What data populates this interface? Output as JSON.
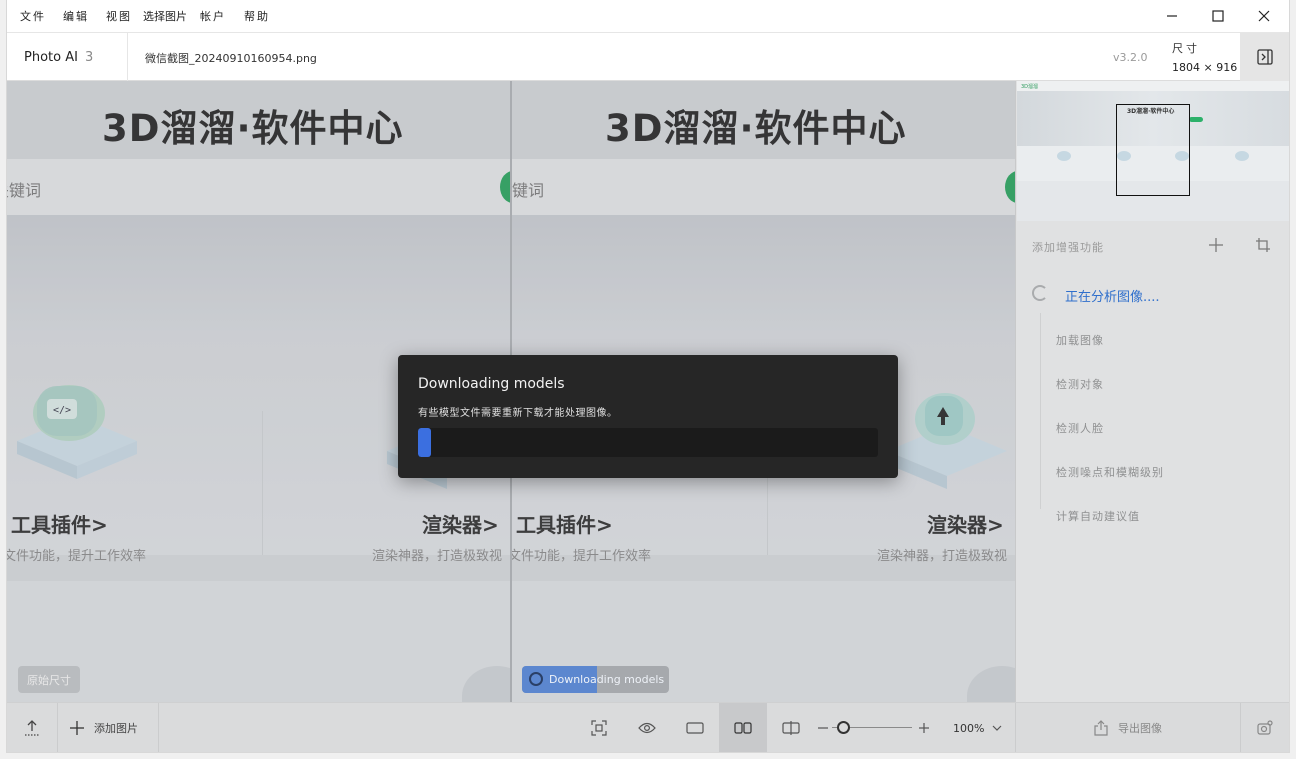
{
  "menu": [
    "文件",
    "编辑",
    "视图",
    "选择图片",
    "帐户",
    "帮助"
  ],
  "window_controls": [
    "minimize-icon",
    "maximize-icon",
    "close-icon"
  ],
  "header": {
    "app_name": "Photo AI",
    "image_count": "3",
    "filename": "微信截图_20240910160954.png",
    "version": "v3.2.0",
    "size_label": "尺寸",
    "size_value": "1804 × 916"
  },
  "preview": {
    "banner_title": "3D溜溜·软件中心",
    "search_hint": "关键词",
    "card_left_title": "工具插件>",
    "card_left_sub": "文件功能，提升工作效率",
    "card_right_title": "渲染器>",
    "card_right_sub": "渲染神器，打造极致视",
    "original_size_pill": "原始尺寸",
    "downloading_pill": "Downloading models",
    "downloading_progress": 0.51
  },
  "thumbnail": {
    "title": "3D溜溜·软件中心",
    "logo": "3D溜溜"
  },
  "enhancements": {
    "label": "添加增强功能",
    "status": "正在分析图像....",
    "steps": [
      "加载图像",
      "检测对象",
      "检测人脸",
      "检测噪点和模糊级别",
      "计算自动建议值"
    ]
  },
  "toolbar": {
    "add_image": "添加图片",
    "zoom": "100%",
    "export": "导出图像"
  },
  "modal": {
    "title": "Downloading models",
    "message": "有些模型文件需要重新下载才能处理图像。",
    "progress": 0.028
  },
  "colors": {
    "accent": "#3b6fe0",
    "status_blue": "#2f6fcc",
    "brand_green": "#23a35a"
  }
}
